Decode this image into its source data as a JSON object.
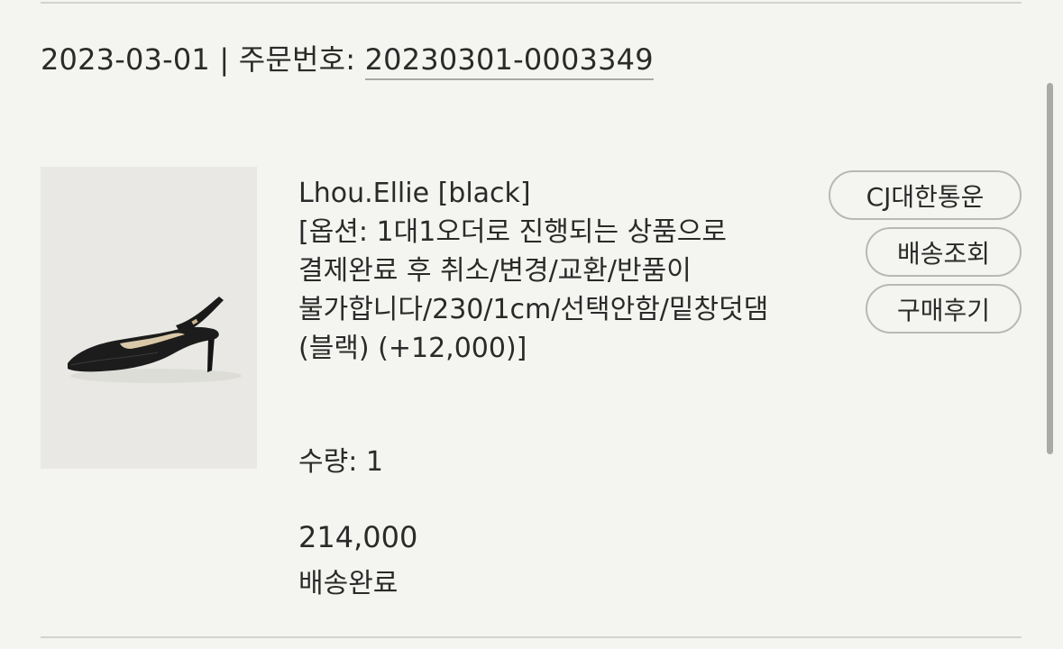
{
  "order": {
    "date": "2023-03-01",
    "separator": " | ",
    "number_label": "주문번호: ",
    "number": "20230301-0003349"
  },
  "item": {
    "name": "Lhou.Ellie [black]",
    "options": "[옵션: 1대1오더로 진행되는 상품으로 결제완료 후 취소/변경/교환/반품이 불가합니다/230/1cm/선택안함/밑창덧댐(블랙) (+12,000)]",
    "quantity_label": "수량: ",
    "quantity": "1",
    "price": "214,000",
    "status": "배송완료",
    "image_icon": "black-slingback-shoe-photo"
  },
  "actions": {
    "carrier": "CJ대한통운",
    "track": "배송조회",
    "review": "구매후기"
  },
  "colors": {
    "background": "#f4f4f0",
    "text": "#2a2a2a",
    "divider": "#d2d2ce",
    "pill_border": "#b8b8b4"
  }
}
